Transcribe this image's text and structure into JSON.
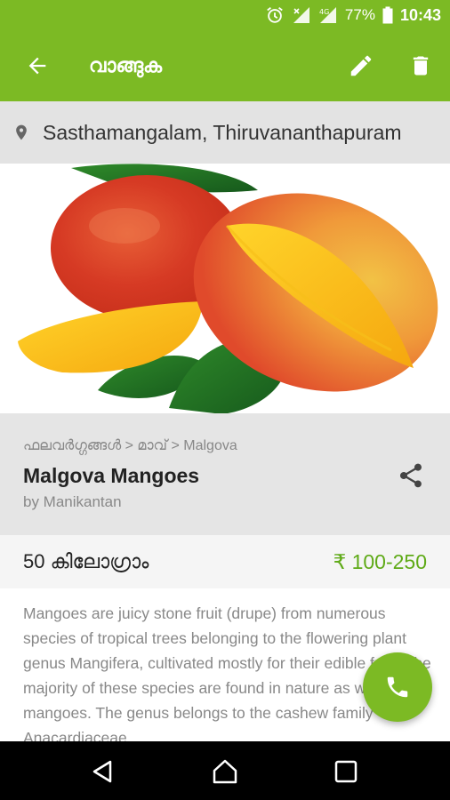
{
  "status_bar": {
    "battery": "77%",
    "time": "10:43"
  },
  "app_bar": {
    "title": "വാങ്ങുക",
    "back_icon": "arrow-back-icon",
    "edit_icon": "pencil-icon",
    "delete_icon": "trash-icon"
  },
  "location": {
    "icon": "map-pin-icon",
    "text": "Sasthamangalam, Thiruvananthapuram"
  },
  "product": {
    "breadcrumb": "ഫലവർഗ്ഗങ്ങൾ > മാവ്  > Malgova",
    "title": "Malgova Mangoes",
    "seller": "by Manikantan",
    "share_icon": "share-icon",
    "quantity": "50 കിലോഗ്രാം",
    "price": "₹ 100-250",
    "description": "Mangoes are juicy stone fruit (drupe) from numerous species of tropical trees belonging to the flowering plant genus Mangifera, cultivated mostly for their edible fruit. The majority of these species are found in nature as wild mangoes. The genus belongs to the cashew family Anacardiaceae."
  },
  "fab": {
    "icon": "phone-icon"
  },
  "nav_bar": {
    "back_icon": "nav-back-icon",
    "home_icon": "nav-home-icon",
    "recents_icon": "nav-recents-icon"
  },
  "colors": {
    "primary": "#7cba24",
    "price": "#5faa17"
  }
}
